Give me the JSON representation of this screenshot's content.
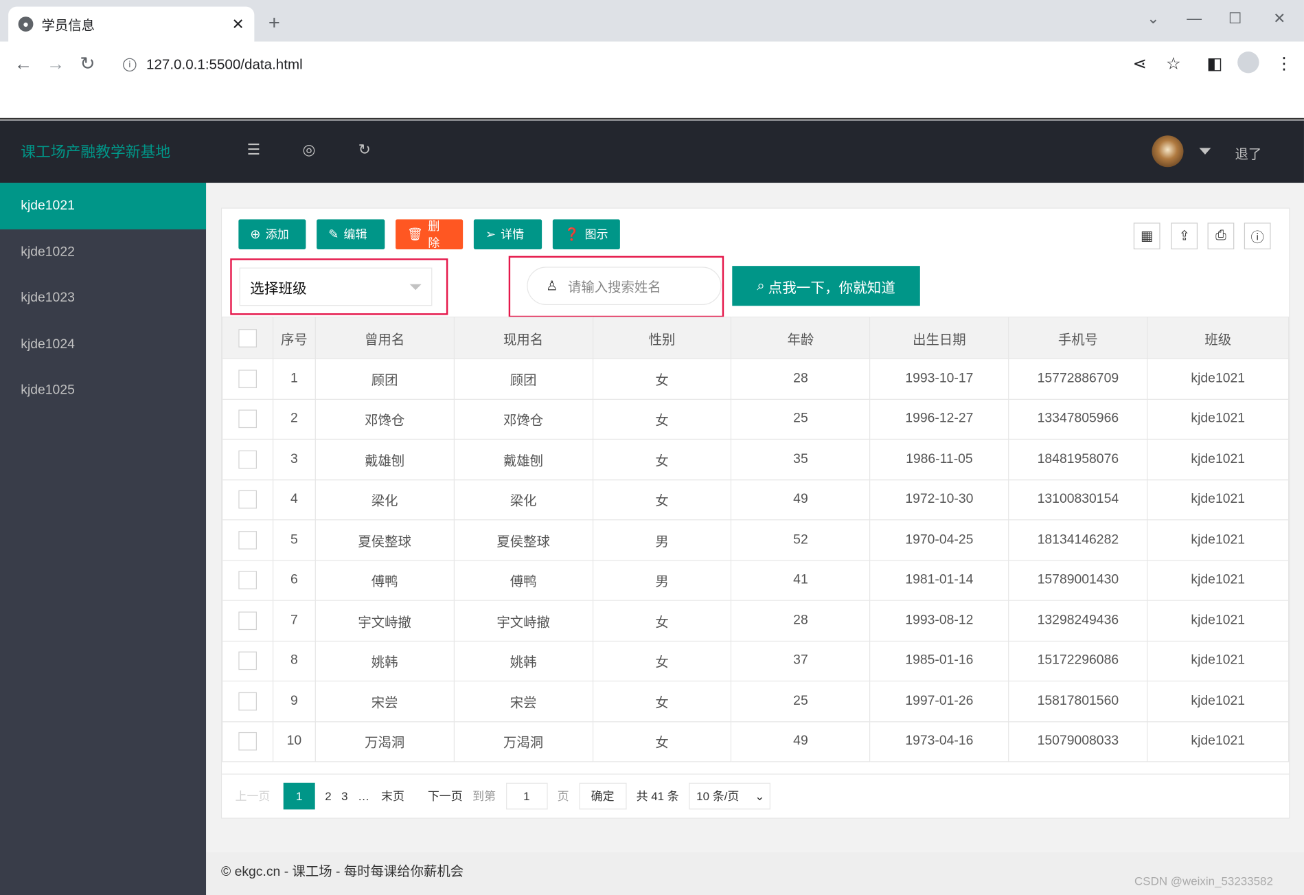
{
  "browser": {
    "tab_title": "学员信息",
    "tab_close": "✕",
    "new_tab": "+",
    "url": "127.0.0.1:5500/data.html",
    "back": "←",
    "forward": "→",
    "reload": "↻",
    "win_chevron": "⌄",
    "win_min": "—",
    "win_max": "☐",
    "win_close": "✕",
    "share": "⋖",
    "star": "☆",
    "sidepanel": "◧",
    "menu": "⋮"
  },
  "header": {
    "brand": "课工场产融教学新基地",
    "logout": "退了",
    "menu_icon": "☰",
    "globe_icon": "◎",
    "refresh_icon": "↻"
  },
  "sidebar": {
    "items": [
      {
        "label": "kjde1021"
      },
      {
        "label": "kjde1022"
      },
      {
        "label": "kjde1023"
      },
      {
        "label": "kjde1024"
      },
      {
        "label": "kjde1025"
      }
    ]
  },
  "toolbar": {
    "add": "添加",
    "edit": "编辑",
    "delete": "删除",
    "detail": "详情",
    "chart": "图示",
    "add_icon": "⊕",
    "edit_icon": "✎",
    "delete_icon": "🗑",
    "detail_icon": "➢",
    "chart_icon": "❓",
    "right_icons": [
      "▦",
      "⇪",
      "⎙",
      "ⓘ"
    ]
  },
  "filters": {
    "class_select": "选择班级",
    "search_placeholder": "请输入搜索姓名",
    "search_button": "点我一下，你就知道",
    "search_icon": "⌕",
    "person_icon": "♙"
  },
  "table": {
    "headers": [
      "序号",
      "曾用名",
      "现用名",
      "性别",
      "年龄",
      "出生日期",
      "手机号",
      "班级"
    ],
    "rows": [
      [
        "1",
        "顾团",
        "顾团",
        "女",
        "28",
        "1993-10-17",
        "15772886709",
        "kjde1021"
      ],
      [
        "2",
        "邓馋仓",
        "邓馋仓",
        "女",
        "25",
        "1996-12-27",
        "13347805966",
        "kjde1021"
      ],
      [
        "3",
        "戴雄刨",
        "戴雄刨",
        "女",
        "35",
        "1986-11-05",
        "18481958076",
        "kjde1021"
      ],
      [
        "4",
        "梁化",
        "梁化",
        "女",
        "49",
        "1972-10-30",
        "13100830154",
        "kjde1021"
      ],
      [
        "5",
        "夏侯整球",
        "夏侯整球",
        "男",
        "52",
        "1970-04-25",
        "18134146282",
        "kjde1021"
      ],
      [
        "6",
        "傅鸭",
        "傅鸭",
        "男",
        "41",
        "1981-01-14",
        "15789001430",
        "kjde1021"
      ],
      [
        "7",
        "宇文峙撤",
        "宇文峙撤",
        "女",
        "28",
        "1993-08-12",
        "13298249436",
        "kjde1021"
      ],
      [
        "8",
        "姚韩",
        "姚韩",
        "女",
        "37",
        "1985-01-16",
        "15172296086",
        "kjde1021"
      ],
      [
        "9",
        "宋尝",
        "宋尝",
        "女",
        "25",
        "1997-01-26",
        "15817801560",
        "kjde1021"
      ],
      [
        "10",
        "万渴洞",
        "万渴洞",
        "女",
        "49",
        "1973-04-16",
        "15079008033",
        "kjde1021"
      ]
    ]
  },
  "pager": {
    "prev": "上一页",
    "p1": "1",
    "p2": "2",
    "p3": "3",
    "ellipsis": "…",
    "last": "末页",
    "next": "下一页",
    "goto": "到第",
    "page_value": "1",
    "page_unit": "页",
    "confirm": "确定",
    "total": "共 41 条",
    "size": "10 条/页"
  },
  "footer": {
    "text": "© ekgc.cn - 课工场 - 每时每课给你薪机会"
  },
  "watermark": "CSDN @weixin_53233582",
  "colors": {
    "accent": "#009688",
    "danger": "#ff5722",
    "header": "#23262e",
    "sidebar": "#393d49",
    "highlight_box": "#e5174a"
  }
}
